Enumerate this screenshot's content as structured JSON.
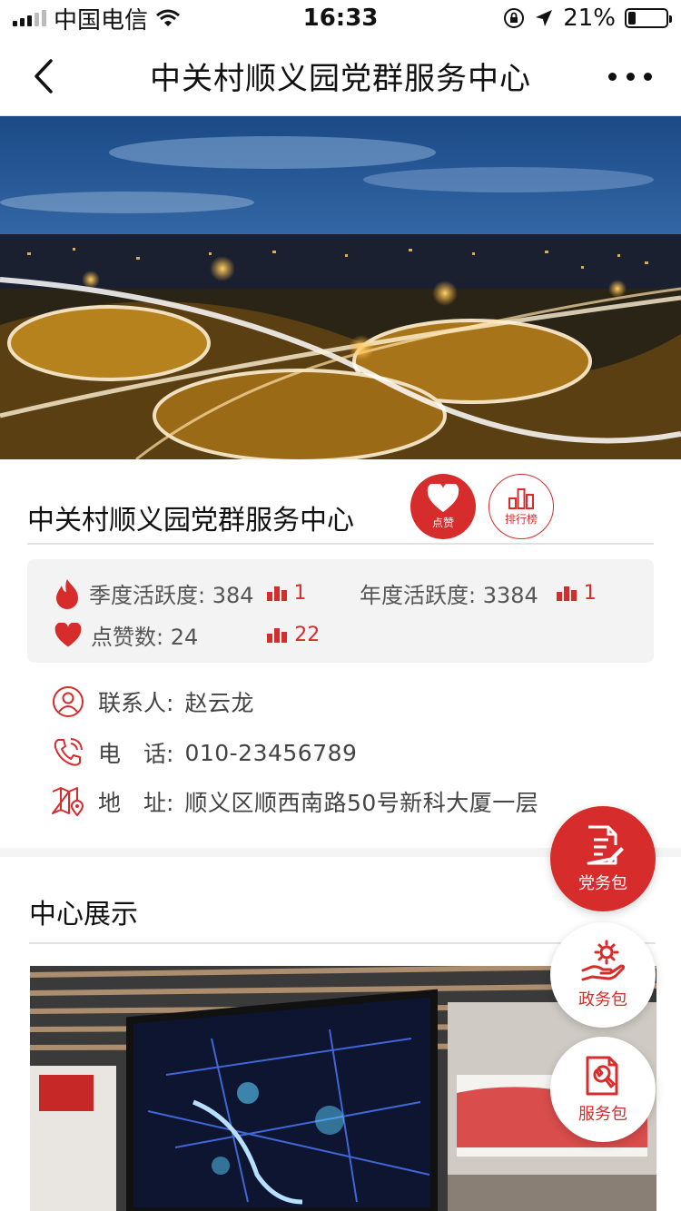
{
  "status_bar": {
    "carrier": "中国电信",
    "time": "16:33",
    "battery": "21%",
    "battery_level": 0.21,
    "icons": [
      "signal-icon",
      "wifi-icon",
      "rotation-lock-icon",
      "location-arrow-icon",
      "battery-icon"
    ]
  },
  "nav": {
    "title": "中关村顺义园党群服务中心",
    "icons": [
      "back-chevron-icon",
      "more-dots-icon"
    ]
  },
  "profile": {
    "name": "中关村顺义园党群服务中心",
    "like_label": "点赞",
    "rank_label": "排行榜"
  },
  "stats": {
    "season": {
      "label": "季度活跃度: 384",
      "rank": "1"
    },
    "year": {
      "label": "年度活跃度: 3384",
      "rank": "1"
    },
    "likes": {
      "label": "点赞数: 24",
      "rank": "22"
    }
  },
  "contact": {
    "person": {
      "label": "联系人:",
      "value": "赵云龙"
    },
    "phone": {
      "label": "电　话:",
      "value": "010-23456789"
    },
    "address": {
      "label": "地　址:",
      "value": "顺义区顺西南路50号新科大厦一层"
    }
  },
  "section": {
    "title": "中心展示"
  },
  "fabs": [
    {
      "label": "党务包",
      "icon": "document-edit-icon"
    },
    {
      "label": "政务包",
      "icon": "hand-gear-icon"
    },
    {
      "label": "服务包",
      "icon": "document-wrench-icon"
    }
  ],
  "colors": {
    "accent": "#d62c2c",
    "text": "#333333",
    "background": "#f4f4f4"
  }
}
